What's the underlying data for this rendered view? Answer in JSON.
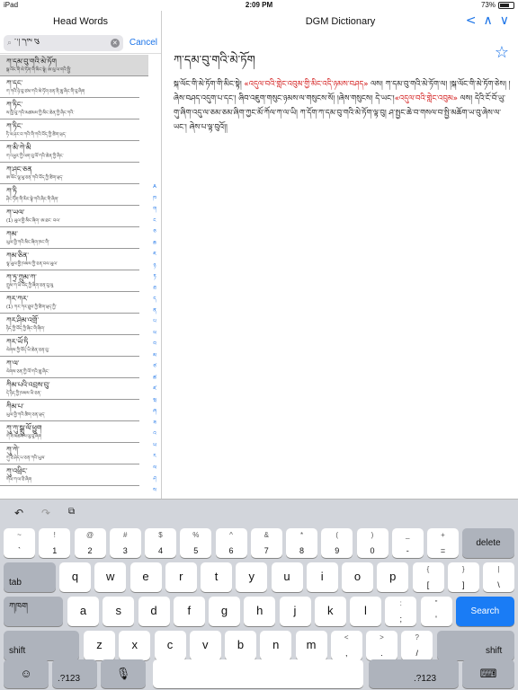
{
  "status": {
    "device": "iPad",
    "time": "2:09 PM",
    "battery": "73%",
    "battery_level": 0.73
  },
  "left": {
    "title": "Head Words",
    "search_value": "ཀ་དམ་བུ",
    "cancel": "Cancel",
    "entries": [
      {
        "hw": "ཀ་དམ་བུ་གའི་མེ་ཏོག",
        "df": "སྐ་ལོང་གི་མེ་ཏོག་གི་མིང་སྟེ། ཨ་ལུ་ལ་གའི་སྤྱི་"
      },
      {
        "hw": "ཀ་དང་",
        "df": "ཀ་ཀའི་ཉེ་བུ་ཙམ་ཀའི་མེ་ཏོག་ཅན་ནི་ཆུ་ཞིང་གི་བུ་ཞིག"
      },
      {
        "hw": "ཀ་ཏིང་",
        "df": "ས་ཁྱི་བུ་ཀའི་མཚམས་ཀྱི་མིང་ཆེན་ཀྱི་ཞིང་ཀའི་"
      },
      {
        "hw": "ཀ་ཏིང་",
        "df": "ཏི་ལ་ཤར་བ་ཀའི་གི་ཀའི་བོད་ཀྱི་ཚིག་ཕྲད་"
      },
      {
        "hw": "ཀ་མི་ཀེ་མི",
        "df": "ཀ་འཕྱར་ཀྱི་ལག་བུ་ལོ་ཀའི་ཆེན་ཀྱི་ཞིང་"
      },
      {
        "hw": "ཀ་ཤང་ཅན",
        "df": "ཨ་ལོང་ལྷ་ཕུ་ཅན་ཀའི་བོད་ཀྱི་ཚིག་ཕྲད་"
      },
      {
        "hw": "ཀ་ཏི",
        "df": "ཤིང་ཏོག་གི་མིང་སྟེ་ཀའི་ཞིང་གི་ཞིག་"
      },
      {
        "hw": "ཀ་ཡལ་",
        "df": "(1) ཡུལ་གྱི་མིང་ཞིག་ ཨ་ཐང་ བལ་"
      },
      {
        "hw": "ཀམ་",
        "df": "ཡུལ་གྱི་ཀའི་མིང་ཞིག་ཁང་གི་"
      },
      {
        "hw": "ཀམ་ཅིན་",
        "df": "ལྷ་ཡུལ་གྱི་ཁམས་ཀྱི་ཅན་བལ་ཡུལ་"
      },
      {
        "hw": "ཀ་ཏྲ་ཀྲུམ་ཀ་",
        "df": "ཀྲུམ་ཀ་ཡི་བོད་ཀྱི་ཞིག་ཅན་བུ་ལུ"
      },
      {
        "hw": "ཀར་ཀར་",
        "df": "(1) ཀར་ཀར་ཐུབ་ཀྱི་ཚིག་ཕྲད་ཀྱི་"
      },
      {
        "hw": "ཀར་ཤིམ་འགྲོ་",
        "df": "ཉིད་ཀྱི་བོད་ཀྱི་ཞིང་གི་ཞིག་"
      },
      {
        "hw": "ཀར་ཡོ་ཏི",
        "df": "ལེགས་ཀྱི་བོད་ཡི་ཆེན་ཅན་བུ་"
      },
      {
        "hw": "ཀ་ལ་",
        "df": "ལེགས་ཅན་ཀྱི་ལོ་ཀའི་ཆུ་ཞིང་"
      },
      {
        "hw": "ཀིམ་པའི་འབྲས་བུ་",
        "df": "དེ་ཉིད་ཀྱི་ཁམས་ཡི་ཅན་"
      },
      {
        "hw": "ཀིམ་པ་",
        "df": "ཡུལ་གྱི་ཀའི་ཚིག་ཅན་ཕྲད་"
      },
      {
        "hw": "ཀུ་ཀུ་སྒྲུ་ལོ་ཕྱུག",
        "df": "ཀེ་ཟི་མཚམས་ལུ་བུ་ཞིག"
      },
      {
        "hw": "ཀུ་ཀེ་",
        "df": "ཀུ་ཅི་ཤེད་པ་ཅན་ཀའི་ཡུལ་"
      },
      {
        "hw": "ཀུ་འཕྲིང་",
        "df": "ཀོལ་ཀ་ལ་ཅི་ཞིག"
      }
    ],
    "index": [
      "A",
      "ཁ",
      "ག",
      "ང",
      "ཅ",
      "ཆ",
      "ཇ",
      "ཉ",
      "ཏ",
      "ཐ",
      "ད",
      "ན",
      "པ",
      "ཕ",
      "བ",
      "མ",
      "ཙ",
      "ཚ",
      "ཛ",
      "ཝ",
      "ཞ",
      "ཟ",
      "འ",
      "ཡ",
      "ར",
      "ལ",
      "ཤ",
      "ས",
      "ཧ",
      "ཨ"
    ]
  },
  "right": {
    "title": "DGM Dictionary",
    "nav_back": "<",
    "nav_up": "∧",
    "nav_down": "∨",
    "headword": "ཀ་དམ་བུ་གའི་མེ་ཏོག",
    "def_part1": "སྐ་ལོང་གི་མེ་ཏོག་གི་མིང་སྟེ། ",
    "def_red1": "«འདུལ་བའི་གླེང་འབུམ་གྱི་མིང་འདི་ཉམས་བཤད»",
    "def_part2": " ལས། ཀ་དམ་བུ་གའི་མེ་ཏོག་ལ། །སྐ་ལོང་གི་མེ་ཏོག་ཅེས། །ཞེས་བཤད་འདུག་པ་དང་། ཞིབ་འཇུག་གསུང་ཉམས་ལ་གསུངས་སོ། །ཞེས་གསུངས། དེ་ཡང་།",
    "def_red2": "«འདུལ་བའི་གླེང་འབུམ»",
    "def_part3": " ལས། དེའི་ངོ་བོ་ཡུ་གུ་ཞིག་འདུ་ལ་ཅམ་ཅམ་ཞིག་ཀྱང་མོ་ཀོལ་ཀ་ལ་ཡི། ཀ་དོག་ཀ་དམ་བུ་གའི་མེ་ཏོག་ལྟ་བུ། ཤ་སྤྱང་ཆེ་བ་གསལ་བ་སྤྱི་མཆོག་ཡ་བུ་ཞེས་ལ་ཡང་། ཞེས་པ་ལྟ་བུའོ།།"
  },
  "keyboard": {
    "num_row": [
      {
        "top": "~",
        "main": "`"
      },
      {
        "top": "!",
        "main": "1"
      },
      {
        "top": "@",
        "main": "2"
      },
      {
        "top": "#",
        "main": "3"
      },
      {
        "top": "$",
        "main": "4"
      },
      {
        "top": "%",
        "main": "5"
      },
      {
        "top": "^",
        "main": "6"
      },
      {
        "top": "&",
        "main": "7"
      },
      {
        "top": "*",
        "main": "8"
      },
      {
        "top": "(",
        "main": "9"
      },
      {
        "top": ")",
        "main": "0"
      },
      {
        "top": "_",
        "main": "-"
      },
      {
        "top": "+",
        "main": "="
      }
    ],
    "delete": "delete",
    "tab": "tab",
    "row_q": [
      "q",
      "w",
      "e",
      "r",
      "t",
      "y",
      "u",
      "i",
      "o",
      "p"
    ],
    "brace_open": {
      "top": "{",
      "main": "["
    },
    "brace_close": {
      "top": "}",
      "main": "]"
    },
    "pipe": {
      "top": "|",
      "main": "\\"
    },
    "lang_key": "ཀཁག",
    "row_a": [
      "a",
      "s",
      "d",
      "f",
      "g",
      "h",
      "j",
      "k",
      "l"
    ],
    "colon": {
      "top": ":",
      "main": ";"
    },
    "quote": {
      "top": "\"",
      "main": "'"
    },
    "search": "Search",
    "shift": "shift",
    "row_z": [
      "z",
      "x",
      "c",
      "v",
      "b",
      "n",
      "m"
    ],
    "lt": {
      "top": "<",
      "main": ","
    },
    "gt": {
      "top": ">",
      "main": "."
    },
    "question": {
      "top": "?",
      "main": "/"
    },
    "num123": ".?123"
  }
}
